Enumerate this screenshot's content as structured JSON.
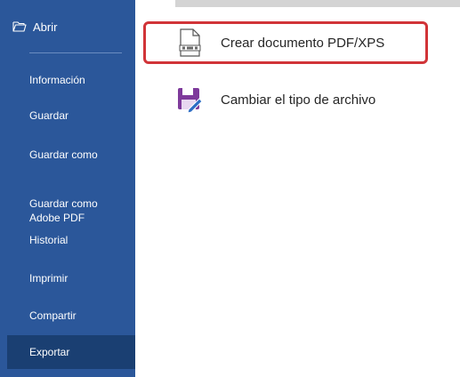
{
  "nav": {
    "open_label": "Abrir",
    "items": [
      {
        "label": "Información"
      },
      {
        "label": "Guardar"
      },
      {
        "label": "Guardar como"
      },
      {
        "label": "Guardar como\nAdobe PDF"
      },
      {
        "label": "Historial"
      },
      {
        "label": "Imprimir"
      },
      {
        "label": "Compartir"
      },
      {
        "label": "Exportar",
        "active": true
      }
    ]
  },
  "main": {
    "options": [
      {
        "label": "Crear documento PDF/XPS",
        "icon": "pdf-document-icon",
        "selected": true
      },
      {
        "label": "Cambiar el tipo de archivo",
        "icon": "save-change-type-icon",
        "selected": false
      }
    ]
  },
  "colors": {
    "nav_bg": "#2b579a",
    "nav_active_bg": "#1a3f72",
    "highlight_border": "#d13438"
  }
}
